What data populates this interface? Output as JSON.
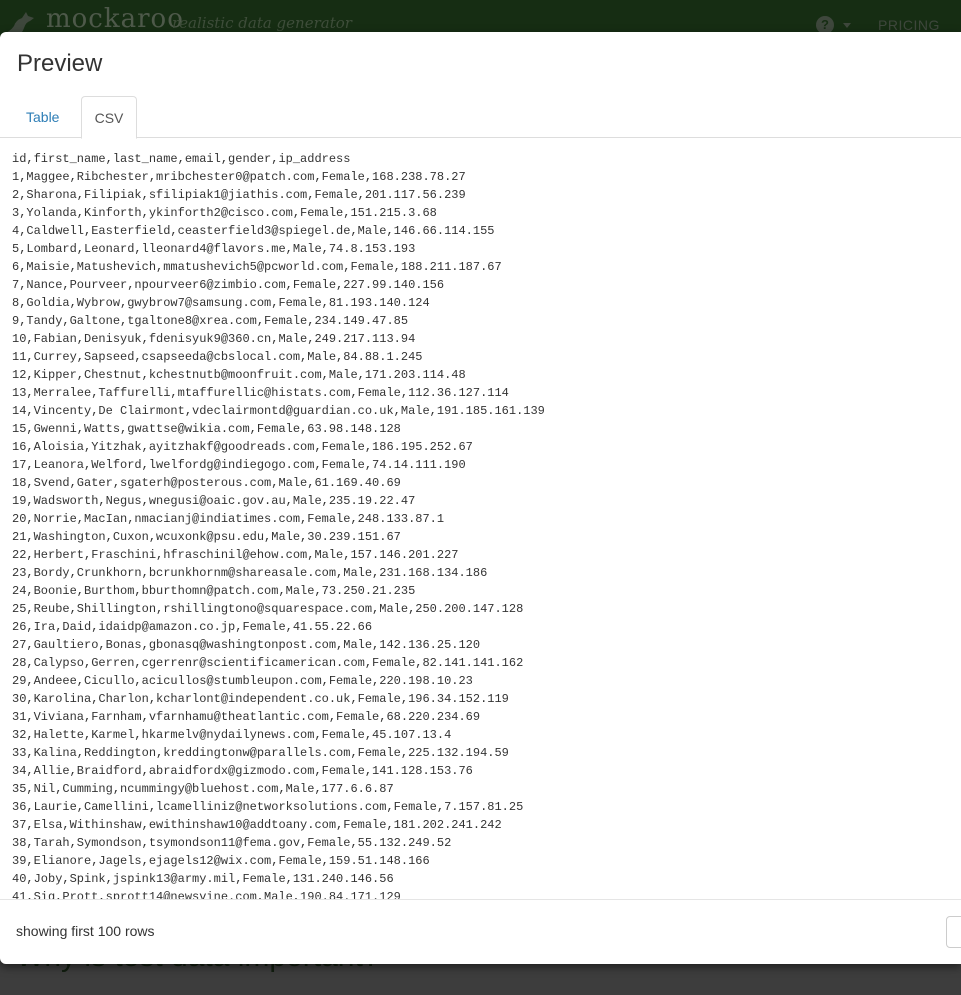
{
  "app": {
    "logo_text": "mockaroo",
    "tagline": "realistic data generator",
    "help_icon": "?",
    "pricing_label": "PRICING",
    "background_heading": "Why is test data important?"
  },
  "modal": {
    "title": "Preview",
    "tabs": [
      {
        "label": "Table",
        "active": false
      },
      {
        "label": "CSV",
        "active": true
      }
    ],
    "csv_lines": [
      "id,first_name,last_name,email,gender,ip_address",
      "1,Maggee,Ribchester,mribchester0@patch.com,Female,168.238.78.27",
      "2,Sharona,Filipiak,sfilipiak1@jiathis.com,Female,201.117.56.239",
      "3,Yolanda,Kinforth,ykinforth2@cisco.com,Female,151.215.3.68",
      "4,Caldwell,Easterfield,ceasterfield3@spiegel.de,Male,146.66.114.155",
      "5,Lombard,Leonard,lleonard4@flavors.me,Male,74.8.153.193",
      "6,Maisie,Matushevich,mmatushevich5@pcworld.com,Female,188.211.187.67",
      "7,Nance,Pourveer,npourveer6@zimbio.com,Female,227.99.140.156",
      "8,Goldia,Wybrow,gwybrow7@samsung.com,Female,81.193.140.124",
      "9,Tandy,Galtone,tgaltone8@xrea.com,Female,234.149.47.85",
      "10,Fabian,Denisyuk,fdenisyuk9@360.cn,Male,249.217.113.94",
      "11,Currey,Sapseed,csapseeda@cbslocal.com,Male,84.88.1.245",
      "12,Kipper,Chestnut,kchestnutb@moonfruit.com,Male,171.203.114.48",
      "13,Merralee,Taffurelli,mtaffurellic@histats.com,Female,112.36.127.114",
      "14,Vincenty,De Clairmont,vdeclairmontd@guardian.co.uk,Male,191.185.161.139",
      "15,Gwenni,Watts,gwattse@wikia.com,Female,63.98.148.128",
      "16,Aloisia,Yitzhak,ayitzhakf@goodreads.com,Female,186.195.252.67",
      "17,Leanora,Welford,lwelfordg@indiegogo.com,Female,74.14.111.190",
      "18,Svend,Gater,sgaterh@posterous.com,Male,61.169.40.69",
      "19,Wadsworth,Negus,wnegusi@oaic.gov.au,Male,235.19.22.47",
      "20,Norrie,MacIan,nmacianj@indiatimes.com,Female,248.133.87.1",
      "21,Washington,Cuxon,wcuxonk@psu.edu,Male,30.239.151.67",
      "22,Herbert,Fraschini,hfraschinil@ehow.com,Male,157.146.201.227",
      "23,Bordy,Crunkhorn,bcrunkhornm@shareasale.com,Male,231.168.134.186",
      "24,Boonie,Burthom,bburthomn@patch.com,Male,73.250.21.235",
      "25,Reube,Shillington,rshillingtono@squarespace.com,Male,250.200.147.128",
      "26,Ira,Daid,idaidp@amazon.co.jp,Female,41.55.22.66",
      "27,Gaultiero,Bonas,gbonasq@washingtonpost.com,Male,142.136.25.120",
      "28,Calypso,Gerren,cgerrenr@scientificamerican.com,Female,82.141.141.162",
      "29,Andeee,Cicullo,acicullos@stumbleupon.com,Female,220.198.10.23",
      "30,Karolina,Charlon,kcharlont@independent.co.uk,Female,196.34.152.119",
      "31,Viviana,Farnham,vfarnhamu@theatlantic.com,Female,68.220.234.69",
      "32,Halette,Karmel,hkarmelv@nydailynews.com,Female,45.107.13.4",
      "33,Kalina,Reddington,kreddingtonw@parallels.com,Female,225.132.194.59",
      "34,Allie,Braidford,abraidfordx@gizmodo.com,Female,141.128.153.76",
      "35,Nil,Cumming,ncummingy@bluehost.com,Male,177.6.6.87",
      "36,Laurie,Camellini,lcamelliniz@networksolutions.com,Female,7.157.81.25",
      "37,Elsa,Withinshaw,ewithinshaw10@addtoany.com,Female,181.202.241.242",
      "38,Tarah,Symondson,tsymondson11@fema.gov,Female,55.132.249.52",
      "39,Elianore,Jagels,ejagels12@wix.com,Female,159.51.148.166",
      "40,Joby,Spink,jspink13@army.mil,Female,131.240.146.56",
      "41,Sig,Prott,sprott14@newsvine.com,Male,190.84.171.129"
    ],
    "footer_note": "showing first 100 rows"
  }
}
